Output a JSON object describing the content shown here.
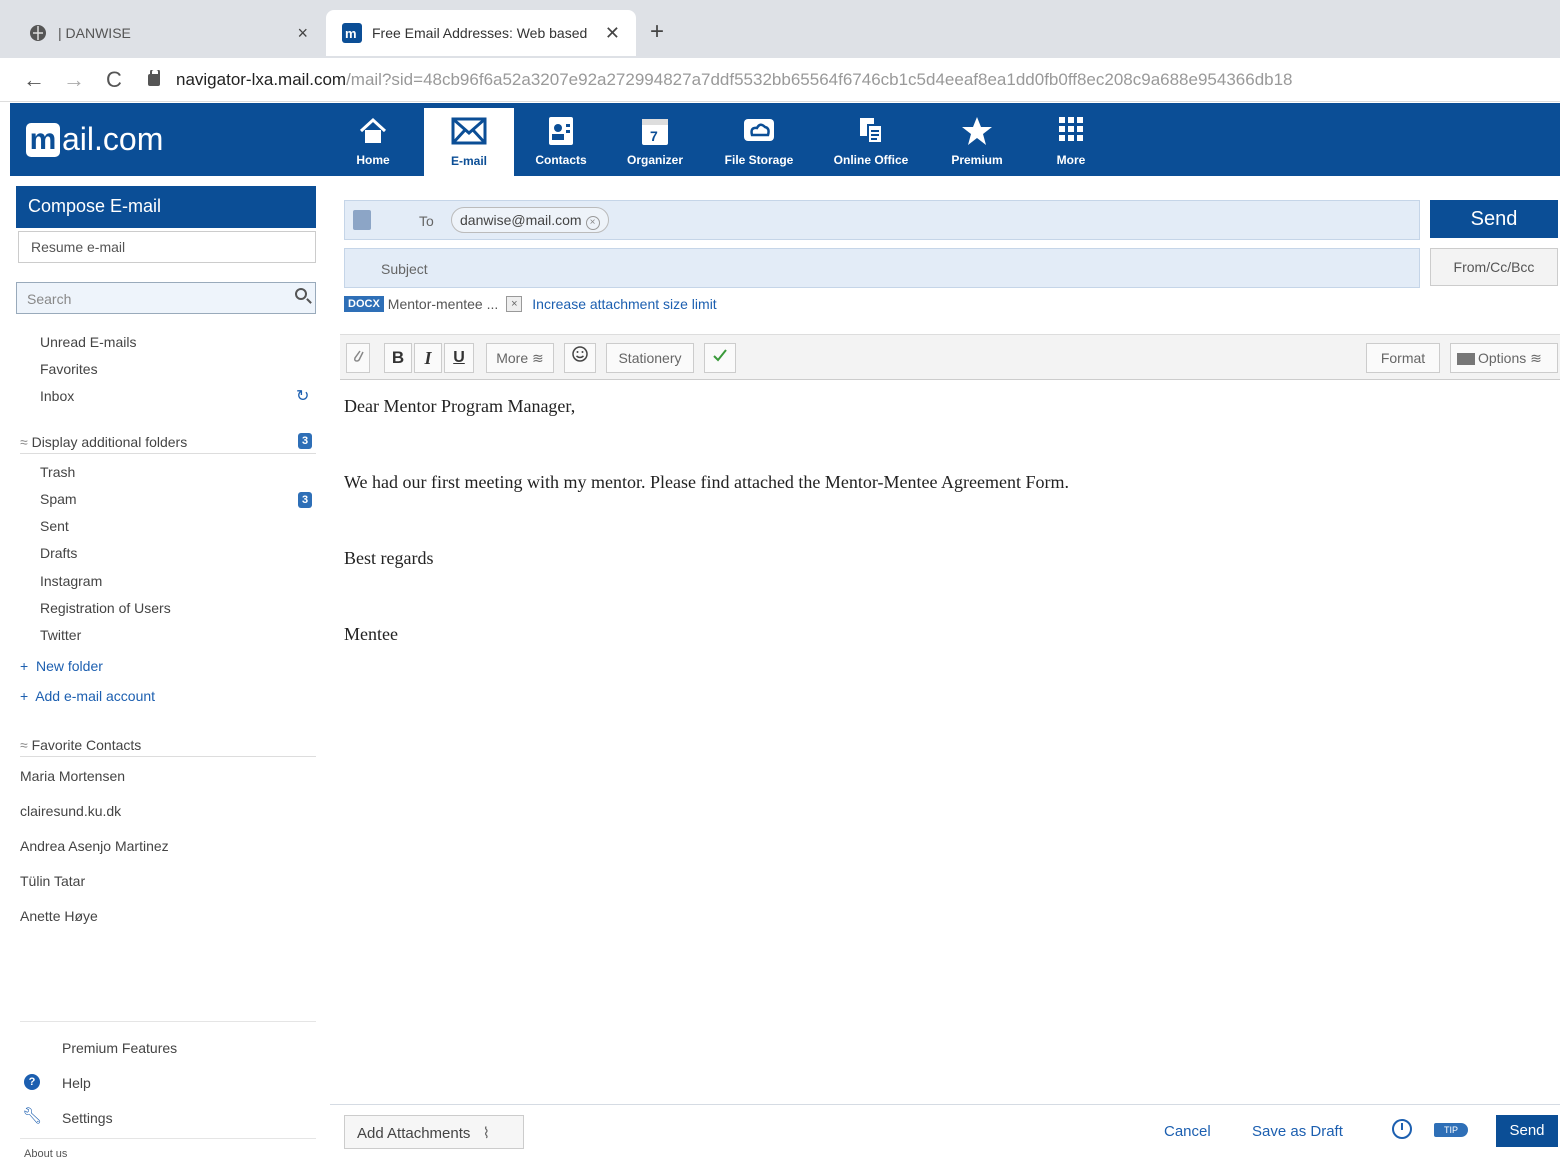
{
  "browser": {
    "tabs": [
      {
        "title": "| DANWISE",
        "close": "×"
      },
      {
        "title": "Free Email Addresses: Web based",
        "close": "✕"
      }
    ],
    "new_tab": "+",
    "url_host": "navigator-lxa.mail.com",
    "url_path": "/mail?sid=48cb96f6a52a3207e92a272994827a7ddf5532bb65564f6746cb1c5d4eeaf8ea1dd0fb0ff8ec208c9a688e954366db18"
  },
  "app": {
    "logo_m": "m",
    "logo_text": "ail.com",
    "nav": [
      {
        "label": "Home",
        "icon": "home-icon"
      },
      {
        "label": "E-mail",
        "icon": "envelope-icon"
      },
      {
        "label": "Contacts",
        "icon": "contacts-icon"
      },
      {
        "label": "Organizer",
        "icon": "calendar-icon"
      },
      {
        "label": "File Storage",
        "icon": "cloud-icon"
      },
      {
        "label": "Online Office",
        "icon": "office-icon"
      },
      {
        "label": "Premium",
        "icon": "star-icon"
      },
      {
        "label": "More",
        "icon": "grid-icon"
      }
    ],
    "calendar_day": "7",
    "accent": "#0b4e96"
  },
  "sidebar": {
    "compose": "Compose E-mail",
    "resume": "Resume e-mail",
    "search_placeholder": "Search",
    "folders": [
      "Unread E-mails",
      "Favorites",
      "Inbox"
    ],
    "additional_header": "Display additional folders",
    "additional_badge": "3",
    "extra_folders": [
      "Trash",
      "Spam",
      "Sent",
      "Drafts",
      "Instagram",
      "Registration of Users",
      "Twitter"
    ],
    "spam_badge": "3",
    "new_folder": "New folder",
    "add_account": "Add e-mail account",
    "contacts_header": "Favorite Contacts",
    "contacts": [
      "Maria Mortensen",
      "clairesund.ku.dk",
      "Andrea Asenjo Martinez",
      "Tülin Tatar",
      "Anette Høye"
    ],
    "premium": "Premium Features",
    "help": "Help",
    "settings": "Settings",
    "about": "About us"
  },
  "compose": {
    "to_label": "To",
    "recipient": "danwise@mail.com",
    "subject_label": "Subject",
    "subject_value": "",
    "send": "Send",
    "from_cc_bcc": "From/Cc/Bcc",
    "attachment_type": "DOCX",
    "attachment_name": "Mentor-mentee ...",
    "increase_limit": "Increase attachment size limit",
    "toolbar": {
      "bold": "B",
      "italic": "I",
      "underline": "U",
      "more": "More ≋",
      "stationery": "Stationery",
      "format": "Format",
      "options": "Options ≋"
    },
    "body_lines": [
      "Dear Mentor Program Manager,",
      "We had our first meeting with my mentor. Please find attached the Mentor-Mentee Agreement Form.",
      "Best regards",
      "Mentee"
    ],
    "bottom": {
      "add_attachments": "Add Attachments",
      "cancel": "Cancel",
      "save_draft": "Save as Draft",
      "tip": "TIP",
      "send": "Send"
    }
  }
}
